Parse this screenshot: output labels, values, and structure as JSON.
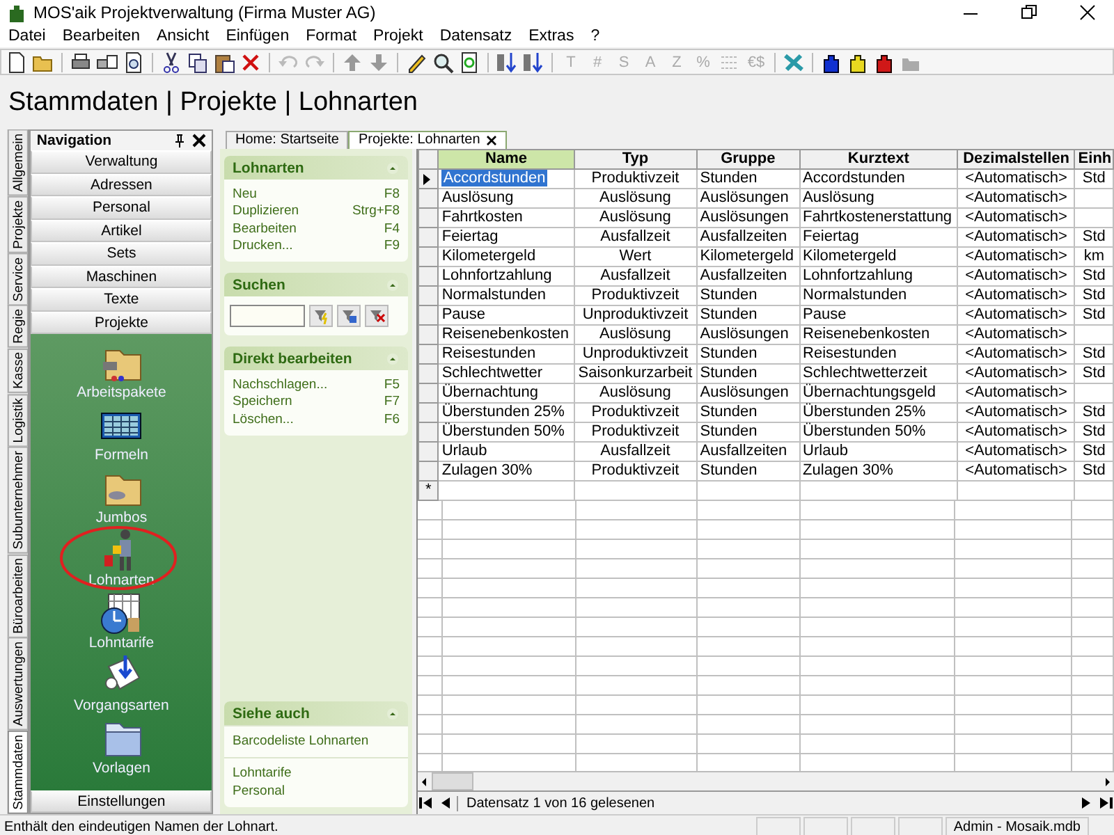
{
  "window": {
    "title": "MOS'aik Projektverwaltung (Firma Muster AG)"
  },
  "menu": [
    "Datei",
    "Bearbeiten",
    "Ansicht",
    "Einfügen",
    "Format",
    "Projekt",
    "Datensatz",
    "Extras",
    "?"
  ],
  "toolbar": {
    "format_glyphs": [
      {
        "label": "T",
        "disabled": true
      },
      {
        "label": "#",
        "disabled": true
      },
      {
        "label": "S",
        "disabled": true
      },
      {
        "label": "A",
        "disabled": true
      },
      {
        "label": "Z",
        "disabled": true
      },
      {
        "label": "%",
        "disabled": true
      },
      {
        "label": "€$",
        "disabled": true
      }
    ]
  },
  "heading": "Stammdaten | Projekte | Lohnarten",
  "side_tabs": [
    {
      "label": "Allgemein",
      "selected": false
    },
    {
      "label": "Projekte",
      "selected": false
    },
    {
      "label": "Service",
      "selected": false
    },
    {
      "label": "Regie",
      "selected": false
    },
    {
      "label": "Kasse",
      "selected": false
    },
    {
      "label": "Logistik",
      "selected": false
    },
    {
      "label": "Subunternehmer",
      "selected": false
    },
    {
      "label": "Büroarbeiten",
      "selected": false
    },
    {
      "label": "Auswertungen",
      "selected": false
    },
    {
      "label": "Stammdaten",
      "selected": true
    }
  ],
  "navigation": {
    "title": "Navigation",
    "groups": [
      "Verwaltung",
      "Adressen",
      "Personal",
      "Artikel",
      "Sets",
      "Maschinen",
      "Texte",
      "Projekte"
    ],
    "items": [
      {
        "label": "Arbeitspakete",
        "highlighted": false
      },
      {
        "label": "Formeln",
        "highlighted": false
      },
      {
        "label": "Jumbos",
        "highlighted": false
      },
      {
        "label": "Lohnarten",
        "highlighted": true
      },
      {
        "label": "Lohntarife",
        "highlighted": false
      },
      {
        "label": "Vorgangsarten",
        "highlighted": false
      },
      {
        "label": "Vorlagen",
        "highlighted": false
      }
    ],
    "footer_group": "Einstellungen"
  },
  "doc_tabs": [
    {
      "label": "Home: Startseite",
      "selected": false,
      "closable": false
    },
    {
      "label": "Projekte: Lohnarten",
      "selected": true,
      "closable": true
    }
  ],
  "tasks": {
    "lohnarten": {
      "title": "Lohnarten",
      "items": [
        {
          "label": "Neu",
          "shortcut": "F8"
        },
        {
          "label": "Duplizieren",
          "shortcut": "Strg+F8"
        },
        {
          "label": "Bearbeiten",
          "shortcut": "F4"
        },
        {
          "label": "Drucken...",
          "shortcut": "F9"
        }
      ]
    },
    "suchen": {
      "title": "Suchen"
    },
    "direkt": {
      "title": "Direkt bearbeiten",
      "items": [
        {
          "label": "Nachschlagen...",
          "shortcut": "F5"
        },
        {
          "label": "Speichern",
          "shortcut": "F7"
        },
        {
          "label": "Löschen...",
          "shortcut": "F6"
        }
      ]
    },
    "siehe_auch": {
      "title": "Siehe auch",
      "groups": [
        [
          "Barcodeliste Lohnarten"
        ],
        [
          "Lohntarife",
          "Personal"
        ]
      ]
    }
  },
  "table": {
    "columns": [
      "Name",
      "Typ",
      "Gruppe",
      "Kurztext",
      "Dezimalstellen",
      "Einh"
    ],
    "rows": [
      {
        "name": "Accordstunden",
        "typ": "Produktivzeit",
        "gruppe": "Stunden",
        "kurztext": "Accordstunden",
        "dezimalstellen": "<Automatisch>",
        "einh": "Std",
        "selected": true
      },
      {
        "name": "Auslösung",
        "typ": "Auslösung",
        "gruppe": "Auslösungen",
        "kurztext": "Auslösung",
        "dezimalstellen": "<Automatisch>",
        "selected": false
      },
      {
        "name": "Fahrtkosten",
        "typ": "Auslösung",
        "gruppe": "Auslösungen",
        "kurztext": "Fahrtkostenerstattung",
        "dezimalstellen": "<Automatisch>",
        "selected": false
      },
      {
        "name": "Feiertag",
        "typ": "Ausfallzeit",
        "gruppe": "Ausfallzeiten",
        "kurztext": "Feiertag",
        "dezimalstellen": "<Automatisch>",
        "einh": "Std",
        "selected": false
      },
      {
        "name": "Kilometergeld",
        "typ": "Wert",
        "gruppe": "Kilometergeld",
        "kurztext": "Kilometergeld",
        "dezimalstellen": "<Automatisch>",
        "einh": "km",
        "selected": false
      },
      {
        "name": "Lohnfortzahlung",
        "typ": "Ausfallzeit",
        "gruppe": "Ausfallzeiten",
        "kurztext": "Lohnfortzahlung",
        "dezimalstellen": "<Automatisch>",
        "einh": "Std",
        "selected": false
      },
      {
        "name": "Normalstunden",
        "typ": "Produktivzeit",
        "gruppe": "Stunden",
        "kurztext": "Normalstunden",
        "dezimalstellen": "<Automatisch>",
        "einh": "Std",
        "selected": false
      },
      {
        "name": "Pause",
        "typ": "Unproduktivzeit",
        "gruppe": "Stunden",
        "kurztext": "Pause",
        "dezimalstellen": "<Automatisch>",
        "einh": "Std",
        "selected": false
      },
      {
        "name": "Reisenebenkosten",
        "typ": "Auslösung",
        "gruppe": "Auslösungen",
        "kurztext": "Reisenebenkosten",
        "dezimalstellen": "<Automatisch>",
        "selected": false
      },
      {
        "name": "Reisestunden",
        "typ": "Unproduktivzeit",
        "gruppe": "Stunden",
        "kurztext": "Reisestunden",
        "dezimalstellen": "<Automatisch>",
        "einh": "Std",
        "selected": false
      },
      {
        "name": "Schlechtwetter",
        "typ": "Saisonkurzarbeit",
        "gruppe": "Stunden",
        "kurztext": "Schlechtwetterzeit",
        "dezimalstellen": "<Automatisch>",
        "einh": "Std",
        "selected": false
      },
      {
        "name": "Übernachtung",
        "typ": "Auslösung",
        "gruppe": "Auslösungen",
        "kurztext": "Übernachtungsgeld",
        "dezimalstellen": "<Automatisch>",
        "selected": false
      },
      {
        "name": "Überstunden 25%",
        "typ": "Produktivzeit",
        "gruppe": "Stunden",
        "kurztext": "Überstunden 25%",
        "dezimalstellen": "<Automatisch>",
        "einh": "Std",
        "selected": false
      },
      {
        "name": "Überstunden 50%",
        "typ": "Produktivzeit",
        "gruppe": "Stunden",
        "kurztext": "Überstunden 50%",
        "dezimalstellen": "<Automatisch>",
        "einh": "Std",
        "selected": false
      },
      {
        "name": "Urlaub",
        "typ": "Ausfallzeit",
        "gruppe": "Ausfallzeiten",
        "kurztext": "Urlaub",
        "dezimalstellen": "<Automatisch>",
        "einh": "Std",
        "selected": false
      },
      {
        "name": "Zulagen 30%",
        "typ": "Produktivzeit",
        "gruppe": "Stunden",
        "kurztext": "Zulagen 30%",
        "dezimalstellen": "<Automatisch>",
        "einh": "Std",
        "selected": false
      }
    ],
    "new_row_marker": "*",
    "record_info": "Datensatz 1 von 16 gelesenen"
  },
  "status_bar": {
    "message": "Enthält den eindeutigen Namen der Lohnart.",
    "database": "Admin - Mosaik.mdb"
  }
}
